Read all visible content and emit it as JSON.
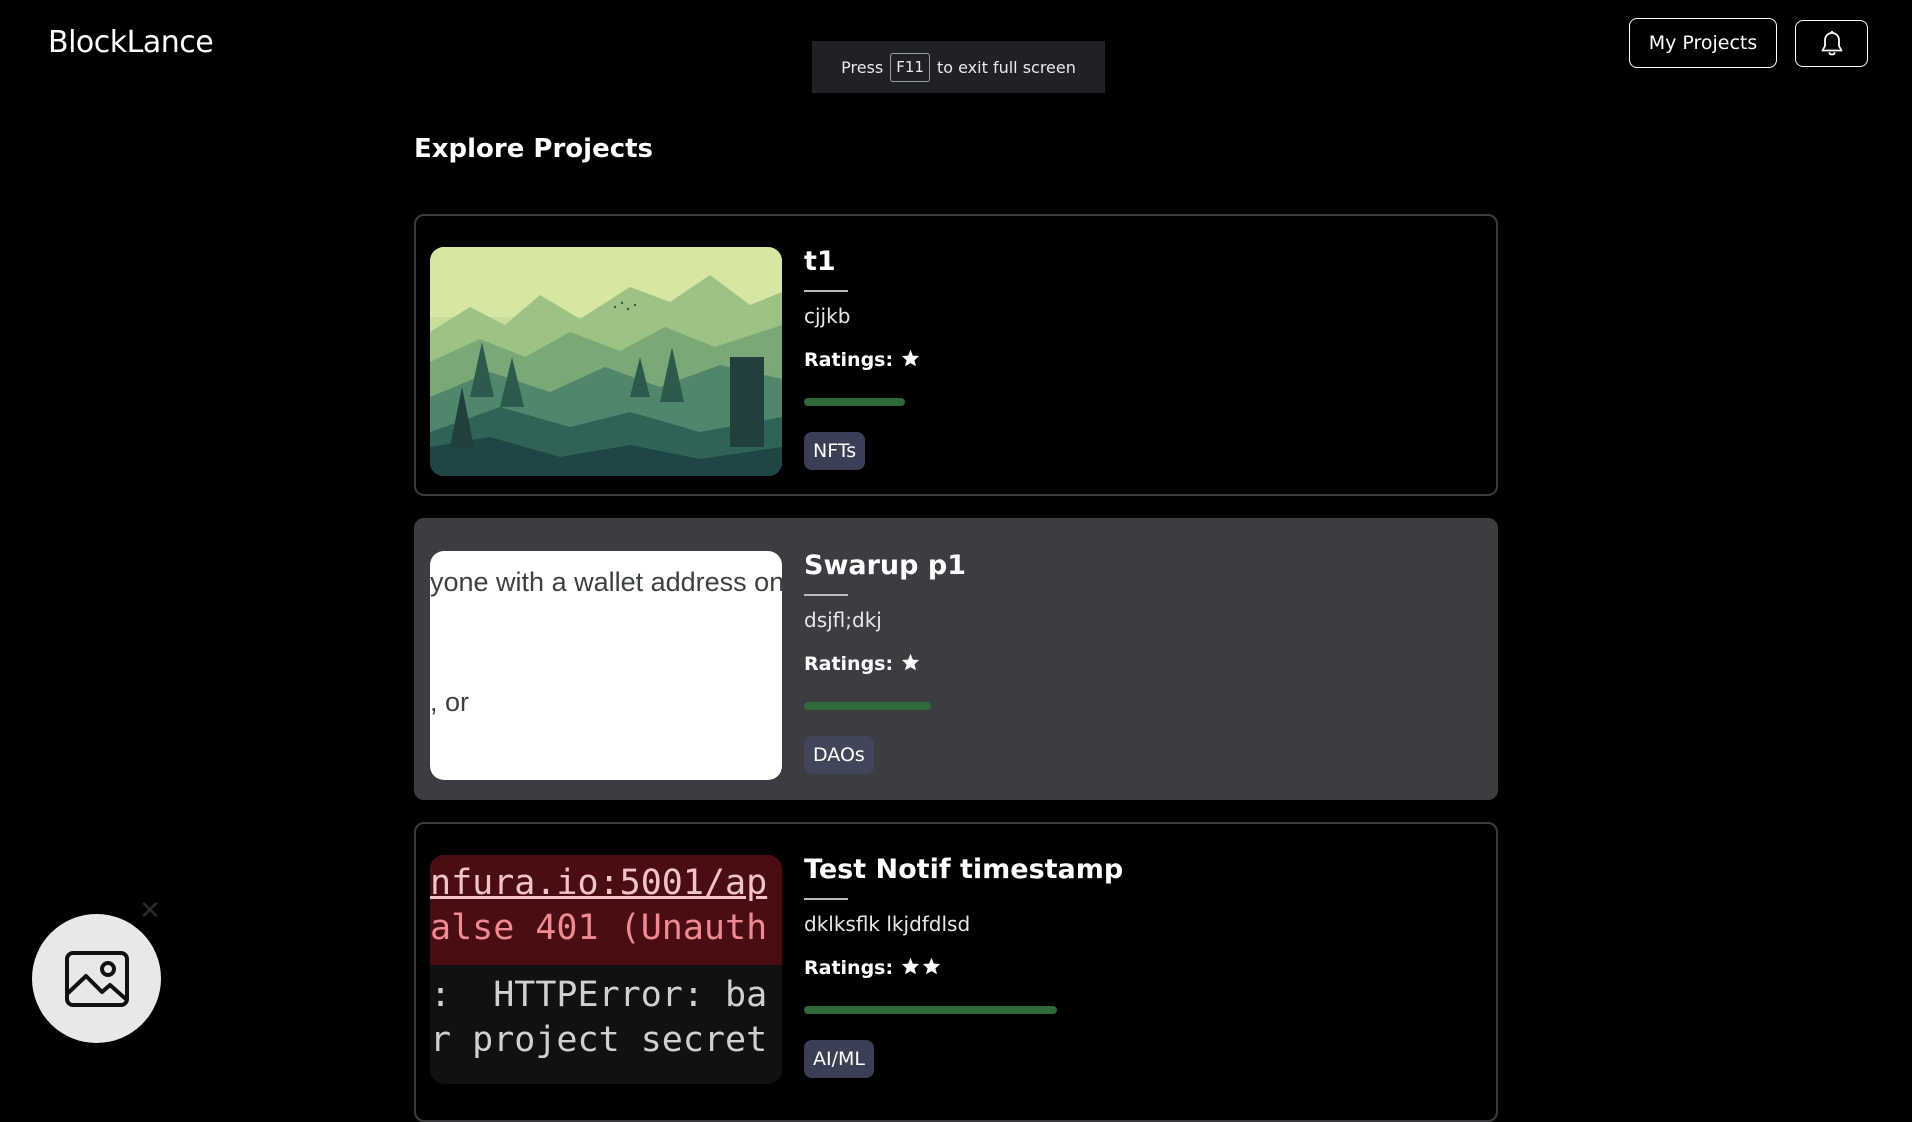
{
  "header": {
    "brand": "BlockLance",
    "my_projects_label": "My Projects",
    "notifications_icon": "bell-icon"
  },
  "fullscreen_notice": {
    "before": "Press",
    "key": "F11",
    "after": "to exit full screen"
  },
  "page_title": "Explore Projects",
  "ratings_label": "Ratings:",
  "projects": [
    {
      "title": "t1",
      "description": "cjjkb",
      "stars": 1,
      "progress": 0.23,
      "tag": "NFTs",
      "thumbnail": "mountain-forest-landscape"
    },
    {
      "title": "Swarup p1",
      "description": "dsjfl;dkj",
      "stars": 1,
      "progress": 0.29,
      "tag": "DAOs",
      "thumbnail": "text-screenshot",
      "thumb_text": [
        "yone with a wallet address on",
        ", or"
      ]
    },
    {
      "title": "Test Notif timestamp",
      "description": "dklksflk lkjdfdlsd",
      "stars": 2,
      "progress": 0.58,
      "tag": "AI/ML",
      "thumbnail": "terminal-error-screenshot",
      "thumb_text": [
        "nfura.io:5001/ap",
        "alse 401 (Unauth",
        ":  HTTPError: ba",
        "r project secret"
      ]
    }
  ],
  "floating_widget": {
    "icon": "image-icon",
    "close_icon": "close-icon"
  }
}
